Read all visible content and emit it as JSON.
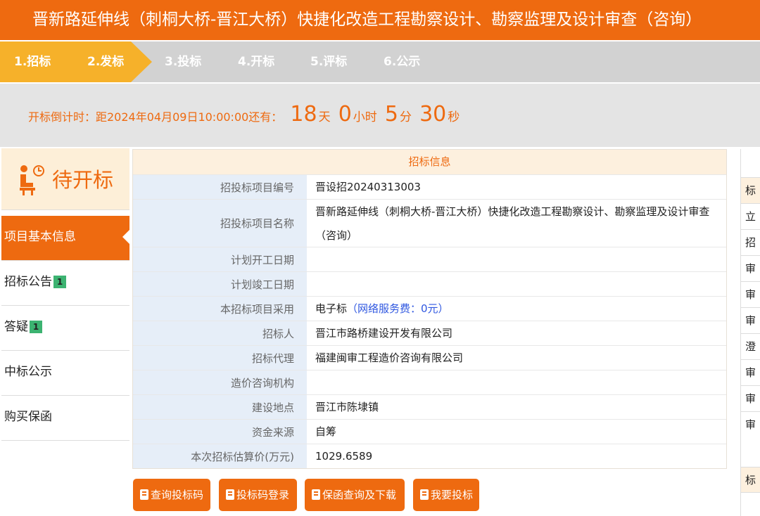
{
  "header": {
    "title": "晋新路延伸线（刺桐大桥-晋江大桥）快捷化改造工程勘察设计、勘察监理及设计审查（咨询）"
  },
  "steps": [
    {
      "label": "1.招标",
      "state": "done"
    },
    {
      "label": "2.发标",
      "state": "done"
    },
    {
      "label": "3.投标",
      "state": "pending"
    },
    {
      "label": "4.开标",
      "state": "pending"
    },
    {
      "label": "5.评标",
      "state": "pending"
    },
    {
      "label": "6.公示",
      "state": "pending"
    }
  ],
  "countdown": {
    "prefix": "开标倒计时：距2024年04月09日10:00:00还有：",
    "days": "18",
    "days_unit": "天",
    "hours": "0",
    "hours_unit": "小时",
    "minutes": "5",
    "minutes_unit": "分",
    "seconds": "30",
    "seconds_unit": "秒"
  },
  "sidebar": {
    "status": "待开标",
    "items": [
      {
        "label": "项目基本信息",
        "badge": "",
        "active": true
      },
      {
        "label": "招标公告",
        "badge": "1",
        "active": false
      },
      {
        "label": "答疑",
        "badge": "1",
        "active": false
      },
      {
        "label": "中标公示",
        "badge": "",
        "active": false
      },
      {
        "label": "购买保函",
        "badge": "",
        "active": false
      }
    ]
  },
  "main": {
    "title": "招标信息",
    "rows": [
      {
        "key": "招投标项目编号",
        "value": "晋设招20240313003"
      },
      {
        "key": "招投标项目名称",
        "value": "晋新路延伸线（刺桐大桥-晋江大桥）快捷化改造工程勘察设计、勘察监理及设计审查（咨询）"
      },
      {
        "key": "计划开工日期",
        "value": ""
      },
      {
        "key": "计划竣工日期",
        "value": ""
      },
      {
        "key": "本招标项目采用",
        "value": "电子标",
        "extra": "（网络服务费：0元）"
      },
      {
        "key": "招标人",
        "value": "晋江市路桥建设开发有限公司"
      },
      {
        "key": "招标代理",
        "value": "福建闽审工程造价咨询有限公司"
      },
      {
        "key": "造价咨询机构",
        "value": ""
      },
      {
        "key": "建设地点",
        "value": "晋江市陈埭镇"
      },
      {
        "key": "资金来源",
        "value": "自筹"
      },
      {
        "key": "本次招标估算价(万元)",
        "value": "1029.6589"
      }
    ]
  },
  "buttons": [
    {
      "label": "查询投标码"
    },
    {
      "label": "投标码登录"
    },
    {
      "label": "保函查询及下载"
    },
    {
      "label": "我要投标"
    }
  ],
  "right_panel": {
    "cells": [
      "标",
      "立",
      "招",
      "审",
      "审",
      "审",
      "澄",
      "审",
      "审",
      "审"
    ],
    "bottom": "标"
  },
  "colors": {
    "accent": "#ee6a10",
    "step_done": "#f6b12a",
    "link": "#2f57e0"
  }
}
